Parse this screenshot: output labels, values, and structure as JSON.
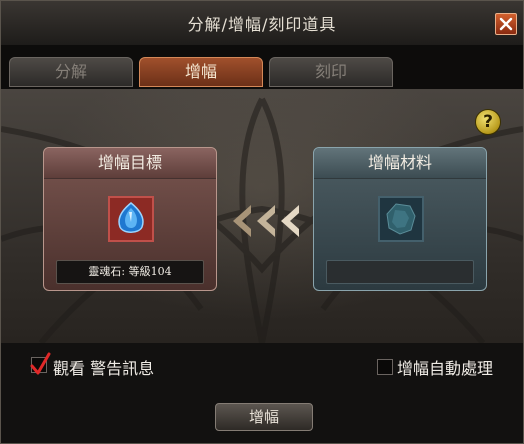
{
  "window": {
    "title": "分解/增幅/刻印道具",
    "close_icon": "close-icon"
  },
  "tabs": [
    {
      "label": "分解",
      "active": false
    },
    {
      "label": "增幅",
      "active": true
    },
    {
      "label": "刻印",
      "active": false
    }
  ],
  "help": {
    "label": "?"
  },
  "target": {
    "header": "增幅目標",
    "item_icon": "blue-soul-gem-icon",
    "caption": "靈魂石: 等級104"
  },
  "material": {
    "header": "增幅材料",
    "item_icon": "gray-stone-icon",
    "caption": ""
  },
  "arrows_icon": "triple-left-arrow-icon",
  "options": {
    "warning": {
      "label": "觀看 警告訊息",
      "checked": true
    },
    "auto": {
      "label": "增幅自動處理",
      "checked": false
    }
  },
  "action_button": {
    "label": "增幅"
  },
  "colors": {
    "active_tab": "#8a4020",
    "target_box": "#6a4844",
    "material_box": "#42525a",
    "check_mark": "#e02828"
  }
}
